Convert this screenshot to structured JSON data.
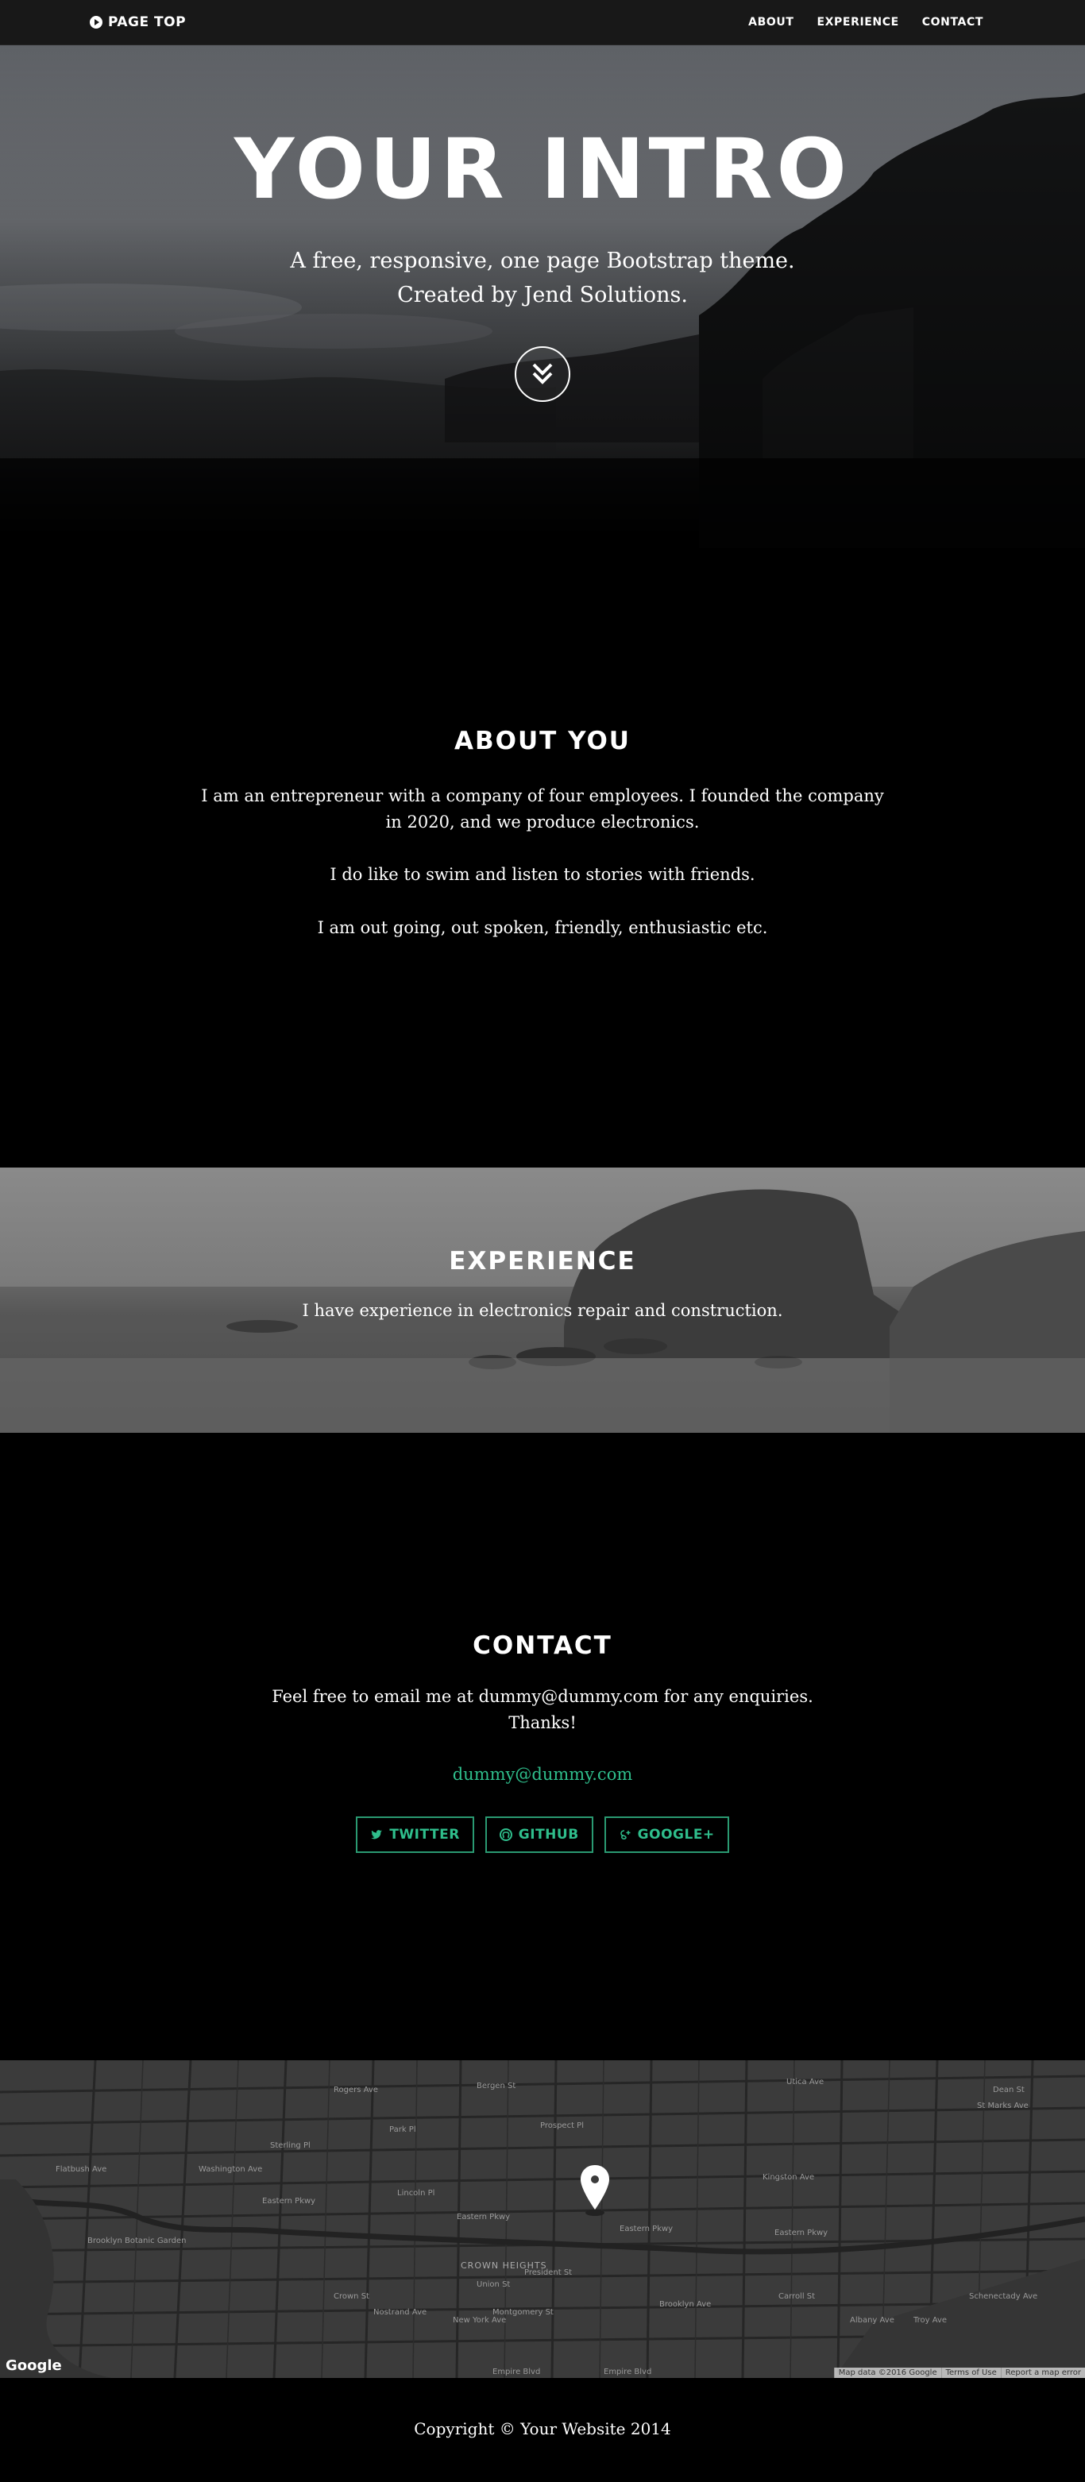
{
  "nav": {
    "brand": "PAGE TOP",
    "links": [
      "ABOUT",
      "EXPERIENCE",
      "CONTACT"
    ]
  },
  "hero": {
    "title": "YOUR INTRO",
    "subtitle_line1": "A free, responsive, one page Bootstrap theme.",
    "subtitle_line2": "Created by Jend Solutions."
  },
  "about": {
    "title": "ABOUT YOU",
    "p1_line1": "I am an entrepreneur with a company of four employees. I founded the company",
    "p1_line2": "in 2020, and we produce electronics.",
    "p2": "I do like to swim and listen to stories with friends.",
    "p3": "I am out going, out spoken, friendly, enthusiastic etc."
  },
  "experience": {
    "title": "EXPERIENCE",
    "text": "I have experience in electronics repair and construction."
  },
  "contact": {
    "title": "CONTACT",
    "text_line1": "Feel free to email me at dummy@dummy.com for any enquiries.",
    "text_line2": "Thanks!",
    "email": "dummy@dummy.com",
    "social": [
      "TWITTER",
      "GITHUB",
      "GOOGLE+"
    ],
    "accent_color": "#2fbe8c"
  },
  "map": {
    "logo": "Google",
    "attribution": [
      "Map data ©2016 Google",
      "Terms of Use",
      "Report a map error"
    ],
    "neighborhood": "CROWN HEIGHTS",
    "street_labels": [
      "Eastern Pkwy",
      "Eastern Pkwy",
      "Eastern Pkwy",
      "Eastern Pkwy",
      "Lincoln Pl",
      "Sterling Pl",
      "Park Pl",
      "Prospect Pl",
      "St Marks Ave",
      "Bergen St",
      "Dean St",
      "Carroll St",
      "Crown St",
      "Montgomery St",
      "Empire Blvd",
      "Empire Blvd",
      "Union St",
      "President St",
      "Brooklyn Botanic Garden",
      "Flatbush Ave",
      "Washington Ave",
      "Rogers Ave",
      "Nostrand Ave",
      "New York Ave",
      "Brooklyn Ave",
      "Kingston Ave",
      "Albany Ave",
      "Troy Ave",
      "Schenectady Ave",
      "Utica Ave"
    ]
  },
  "footer": {
    "copyright": "Copyright © Your Website 2014"
  }
}
